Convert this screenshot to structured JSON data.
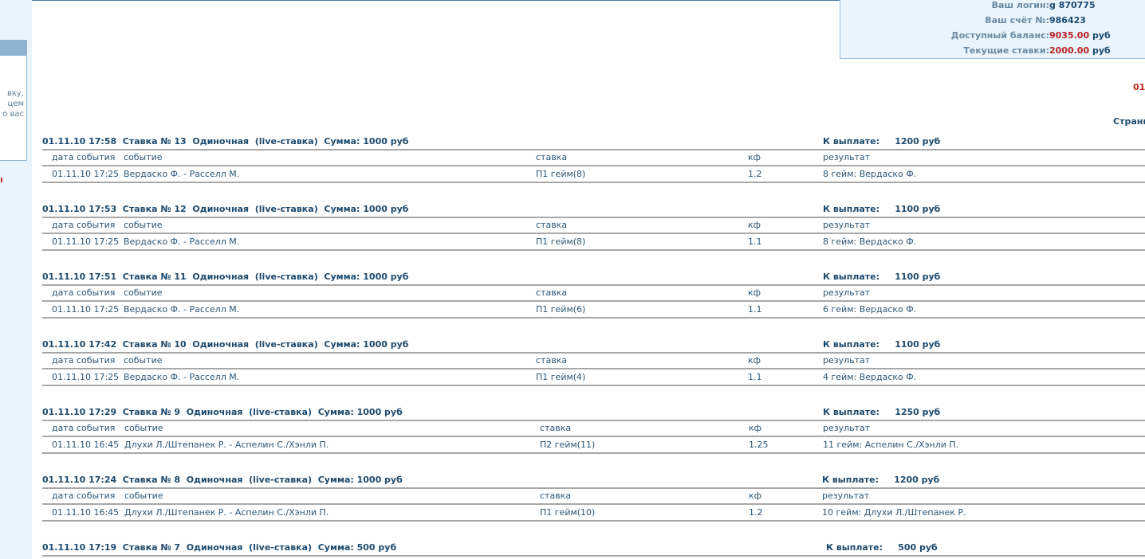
{
  "left_panel": {
    "text_lines": [
      "вку,",
      "цем",
      "о вас"
    ],
    "mark": "ı"
  },
  "account": {
    "login_label": "Ваш логин:",
    "login_value": "g 870775",
    "account_label": "Ваш счёт №:",
    "account_value": "986423",
    "balance_label": "Доступный баланс:",
    "balance_amount": "9035.00",
    "balance_currency": "руб",
    "current_label": "Текущие ставки:",
    "current_amount": "2000.00",
    "current_currency": "руб"
  },
  "red_edge_text": "01",
  "pager_label": "Страни",
  "columns": {
    "date": "дата события",
    "event": "событие",
    "stake": "ставка",
    "coef": "кф",
    "result": "результат"
  },
  "bets": [
    {
      "title": "01.11.10 17:58  Ставка № 13  Одиночная  (live-ставка)  Сумма: 1000 руб",
      "payout": "К выплате:     1200 руб",
      "row": {
        "date": "01.11.10 17:25",
        "event": "Вердаско Ф. - Расселл М.",
        "stake": "П1 гейм(8)",
        "coef": "1.2",
        "result": "8 гейм: Вердаско Ф."
      }
    },
    {
      "title": "01.11.10 17:53  Ставка № 12  Одиночная  (live-ставка)  Сумма: 1000 руб",
      "payout": "К выплате:     1100 руб",
      "row": {
        "date": "01.11.10 17:25",
        "event": "Вердаско Ф. - Расселл М.",
        "stake": "П1 гейм(8)",
        "coef": "1.1",
        "result": "8 гейм: Вердаско Ф."
      }
    },
    {
      "title": "01.11.10 17:51  Ставка № 11  Одиночная  (live-ставка)  Сумма: 1000 руб",
      "payout": "К выплате:     1100 руб",
      "row": {
        "date": "01.11.10 17:25",
        "event": "Вердаско Ф. - Расселл М.",
        "stake": "П1 гейм(6)",
        "coef": "1.1",
        "result": "6 гейм: Вердаско Ф."
      }
    },
    {
      "title": "01.11.10 17:42  Ставка № 10  Одиночная  (live-ставка)  Сумма: 1000 руб",
      "payout": "К выплате:     1100 руб",
      "row": {
        "date": "01.11.10 17:25",
        "event": "Вердаско Ф. - Расселл М.",
        "stake": "П1 гейм(4)",
        "coef": "1.1",
        "result": "4 гейм: Вердаско Ф."
      }
    },
    {
      "title": "01.11.10 17:29  Ставка № 9  Одиночная  (live-ставка)  Сумма: 1000 руб",
      "payout": "К выплате:     1250 руб",
      "row": {
        "date": "01.11.10 16:45",
        "event": "Длухи Л./Штепанек Р. - Аспелин С./Хэнли П.",
        "stake": "П2 гейм(11)",
        "coef": "1.25",
        "result": "11 гейм: Аспелин С./Хэнли П."
      }
    },
    {
      "title": "01.11.10 17:24  Ставка № 8  Одиночная  (live-ставка)  Сумма: 1000 руб",
      "payout": "К выплате:     1200 руб",
      "row": {
        "date": "01.11.10 16:45",
        "event": "Длухи Л./Штепанек Р. - Аспелин С./Хэнли П.",
        "stake": "П1 гейм(10)",
        "coef": "1.2",
        "result": "10 гейм: Длухи Л./Штепанек Р."
      }
    },
    {
      "title": "01.11.10 17:19  Ставка № 7  Одиночная  (live-ставка)  Сумма: 500 руб",
      "payout": "К выплате:     500 руб"
    }
  ]
}
